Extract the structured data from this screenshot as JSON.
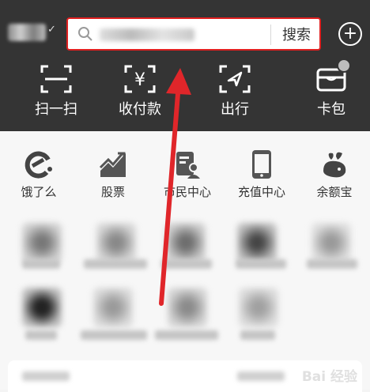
{
  "search": {
    "button_label": "搜索"
  },
  "header": {
    "shortcuts": [
      {
        "label": "扫一扫",
        "icon": "scan-icon"
      },
      {
        "label": "收付款",
        "icon": "payment-code-icon"
      },
      {
        "label": "出行",
        "icon": "travel-icon"
      },
      {
        "label": "卡包",
        "icon": "card-wallet-icon"
      }
    ]
  },
  "apps": [
    {
      "label": "饿了么",
      "icon": "eleme-icon"
    },
    {
      "label": "股票",
      "icon": "stock-chart-icon"
    },
    {
      "label": "市民中心",
      "icon": "citizen-center-icon"
    },
    {
      "label": "充值中心",
      "icon": "phone-recharge-icon"
    },
    {
      "label": "余额宝",
      "icon": "yuebao-icon"
    }
  ],
  "watermark": "Bai 经验",
  "colors": {
    "header_bg": "#343434",
    "highlight": "#e02020",
    "arrow": "#e0262a"
  }
}
